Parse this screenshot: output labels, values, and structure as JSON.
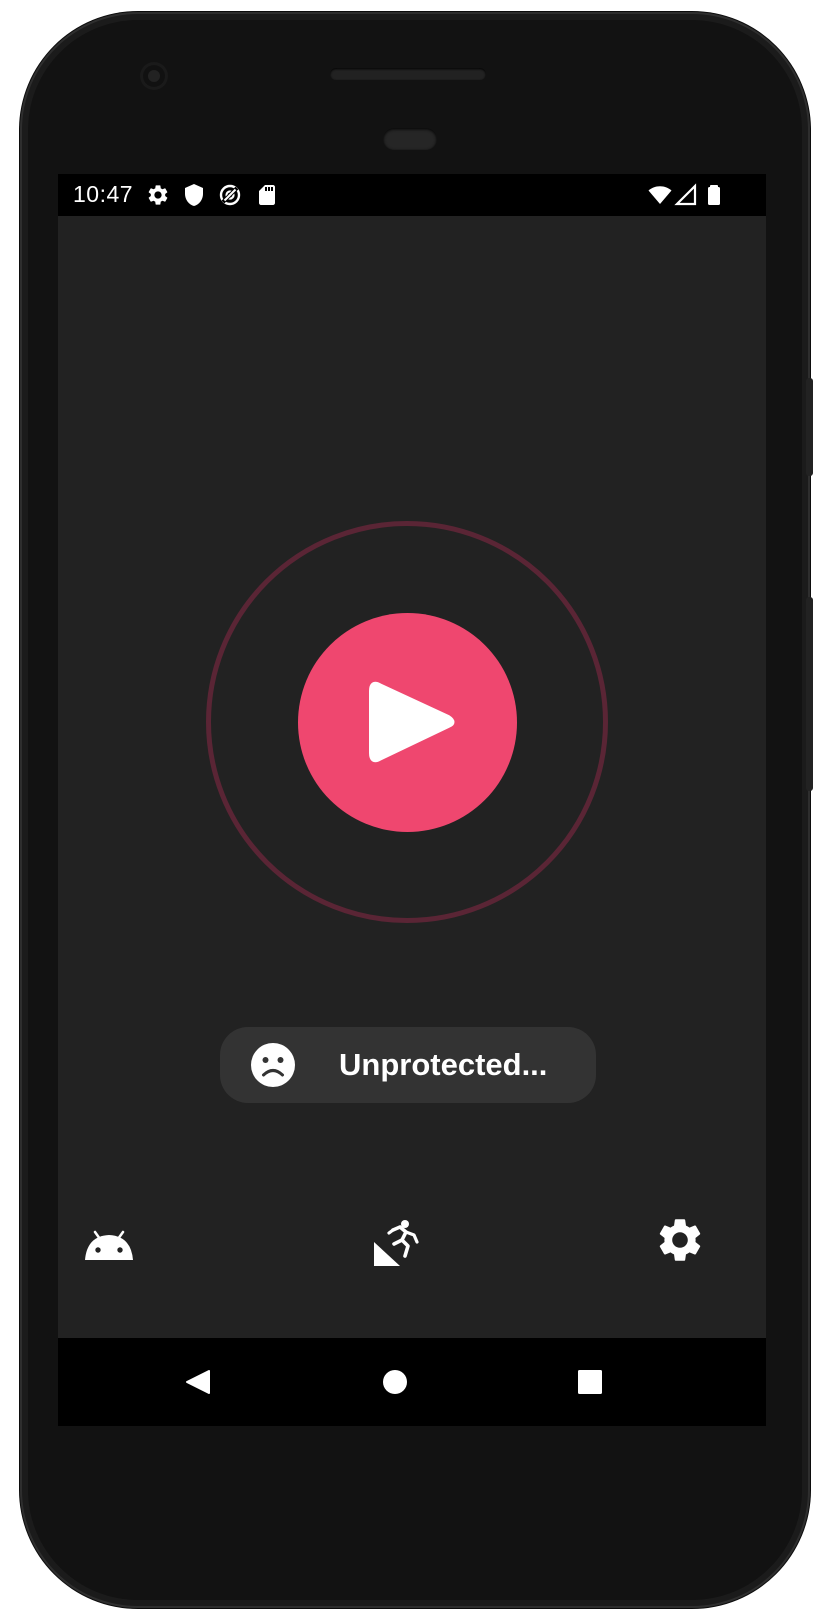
{
  "status_bar": {
    "time": "10:47",
    "left_icons": [
      "gear-icon",
      "shield-icon",
      "data-saver-icon",
      "sd-card-icon"
    ],
    "right_icons": [
      "wifi-icon",
      "cellular-signal-icon",
      "battery-icon"
    ]
  },
  "main": {
    "play_button_icon": "play-icon",
    "status_text": "Unprotected...",
    "status_face_icon": "sad-face-icon"
  },
  "bottom_bar": {
    "icons": [
      "android-icon",
      "person-falling-icon",
      "gear-icon"
    ]
  },
  "nav_bar": {
    "icons": [
      "back-icon",
      "home-icon",
      "recents-icon"
    ]
  },
  "colors": {
    "screen_background": "#222222",
    "accent": "#ef476f",
    "ring": "#5a2535",
    "pill_background": "#333333",
    "status_bar": "#000000"
  }
}
